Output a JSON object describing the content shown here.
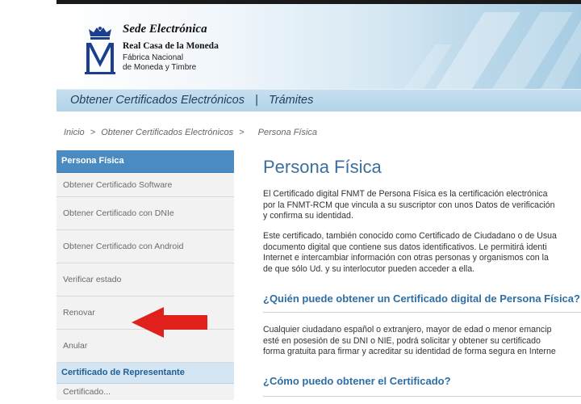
{
  "header": {
    "brand_title": "Sede Electrónica",
    "brand_line1": "Real Casa de la Moneda",
    "brand_line2": "Fábrica Nacional",
    "brand_line3": "de Moneda y Timbre",
    "logo_icon": "crown-m-logo"
  },
  "nav": {
    "item1": "Obtener Certificados Electrónicos",
    "separator": "|",
    "item2": "Trámites"
  },
  "breadcrumb": {
    "items": [
      "Inicio",
      "Obtener Certificados Electrónicos",
      "Persona Física"
    ],
    "separator": ">"
  },
  "sidebar": {
    "heading": "Persona Física",
    "items": [
      {
        "label": "Obtener Certificado Software"
      },
      {
        "label": "Obtener Certificado con DNIe"
      },
      {
        "label": "Obtener Certificado con Android"
      },
      {
        "label": "Verificar estado"
      },
      {
        "label": "Renovar"
      },
      {
        "label": "Anular"
      }
    ],
    "heading2": "Certificado de Representante",
    "partial_item": "Certificado..."
  },
  "annotation": {
    "arrow_icon": "red-arrow-left-icon",
    "arrow_color": "#e0201b"
  },
  "content": {
    "title": "Persona Física",
    "para1": [
      "El Certificado digital FNMT de Persona Física es la certificación electrónica",
      "por la FNMT-RCM que vincula a su suscriptor con unos Datos de verificación",
      "y confirma su identidad."
    ],
    "para2": [
      "Este certificado, también conocido como Certificado de Ciudadano o de Usua",
      "documento digital que contiene sus datos identificativos. Le permitirá identi",
      "Internet e intercambiar información con otras personas y organismos con la",
      "de que sólo Ud. y su interlocutor pueden acceder a ella."
    ],
    "heading1": "¿Quién puede obtener un Certificado digital de Persona Física?",
    "para3": [
      "Cualquier ciudadano español o extranjero, mayor de edad o menor emancip",
      "esté en posesión de su DNI o NIE, podrá solicitar y obtener su certificado",
      "forma gratuita para firmar y acreditar su identidad de forma segura en Interne"
    ],
    "heading2": "¿Cómo puedo obtener el Certificado?"
  },
  "colors": {
    "accent": "#4a8cc2",
    "title_blue": "#3d6f9e",
    "heading_blue": "#2f6ea4"
  }
}
